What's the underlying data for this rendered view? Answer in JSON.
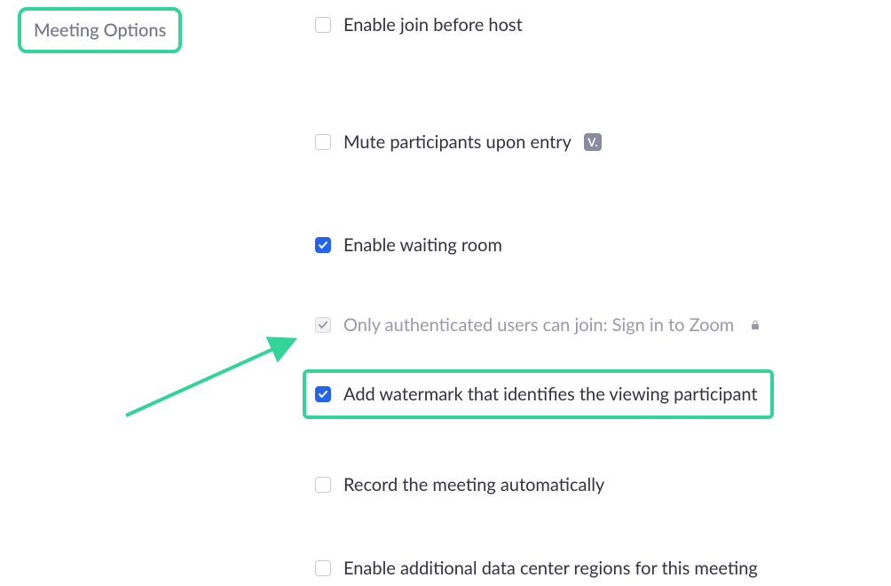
{
  "section": {
    "title": "Meeting Options"
  },
  "options": [
    {
      "label": "Enable join before host",
      "checked": false,
      "disabled": false,
      "badge": false,
      "locked": false
    },
    {
      "label": "Mute participants upon entry",
      "checked": false,
      "disabled": false,
      "badge": true,
      "locked": false
    },
    {
      "label": "Enable waiting room",
      "checked": true,
      "disabled": false,
      "badge": false,
      "locked": false
    },
    {
      "label": "Only authenticated users can join: Sign in to Zoom",
      "checked": true,
      "disabled": true,
      "badge": false,
      "locked": true
    },
    {
      "label": "Add watermark that identifies the viewing participant",
      "checked": true,
      "disabled": false,
      "badge": false,
      "locked": false
    },
    {
      "label": "Record the meeting automatically",
      "checked": false,
      "disabled": false,
      "badge": false,
      "locked": false
    },
    {
      "label": "Enable additional data center regions for this meeting",
      "checked": false,
      "disabled": false,
      "badge": false,
      "locked": false
    }
  ],
  "badge_text": "V.",
  "annotations": {
    "highlight_color": "#34d399",
    "highlighted_option_index": 4
  },
  "row_spacing": [
    0,
    92,
    76,
    50,
    30,
    54,
    54
  ]
}
